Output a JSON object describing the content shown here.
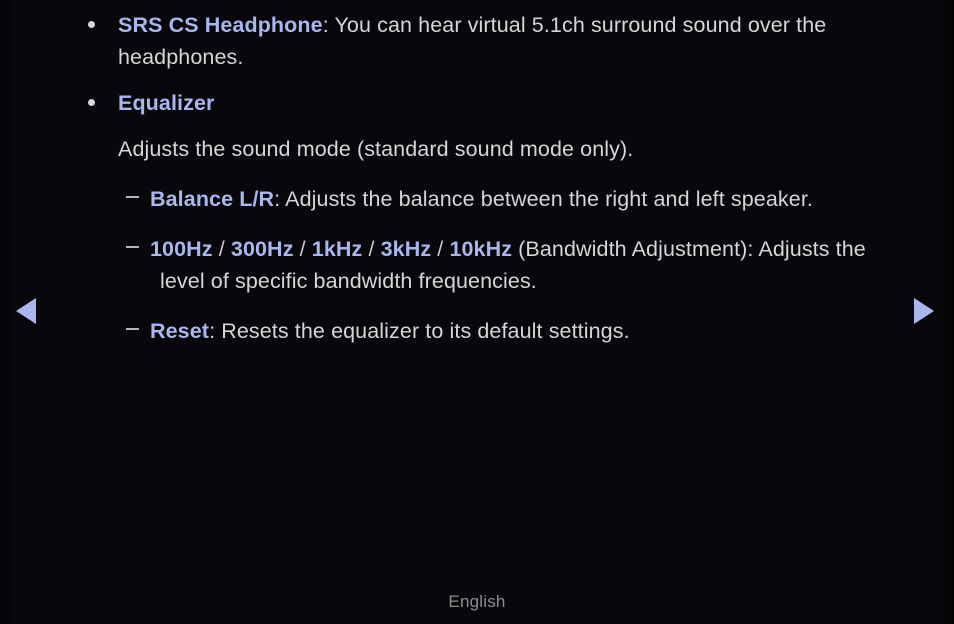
{
  "page": {
    "background_color": "#07070c",
    "body_text_color": "#d6d6d6",
    "accent_color": "#a9b7ee",
    "footer_text_color": "#8e8e8e"
  },
  "content": {
    "items": [
      {
        "level": 1,
        "marker": "bullet",
        "key": "SRS CS Headphone",
        "separator": ": ",
        "text": "You can hear virtual 5.1ch surround sound over the headphones."
      },
      {
        "level": 1,
        "marker": "bullet",
        "key": "Equalizer",
        "separator": "",
        "text": ""
      },
      {
        "level": 1,
        "marker": "none",
        "key": "",
        "separator": "",
        "text": "Adjusts the sound mode (standard sound mode only)."
      },
      {
        "level": 2,
        "marker": "dash",
        "key": "Balance L/R",
        "separator": ": ",
        "text": "Adjusts the balance between the right and left speaker."
      },
      {
        "level": 2,
        "marker": "dash",
        "keys": [
          "100Hz",
          "300Hz",
          "1kHz",
          "3kHz",
          "10kHz"
        ],
        "key_separator": " / ",
        "separator": " ",
        "text": "(Bandwidth Adjustment): Adjusts the level of specific bandwidth frequencies."
      },
      {
        "level": 2,
        "marker": "dash",
        "key": "Reset",
        "separator": ": ",
        "text": "Resets the equalizer to its default settings."
      }
    ]
  },
  "navigation": {
    "prev_label": "Previous page",
    "prev_icon": "triangle-left-icon",
    "next_label": "Next page",
    "next_icon": "triangle-right-icon"
  },
  "footer": {
    "language": "English"
  }
}
